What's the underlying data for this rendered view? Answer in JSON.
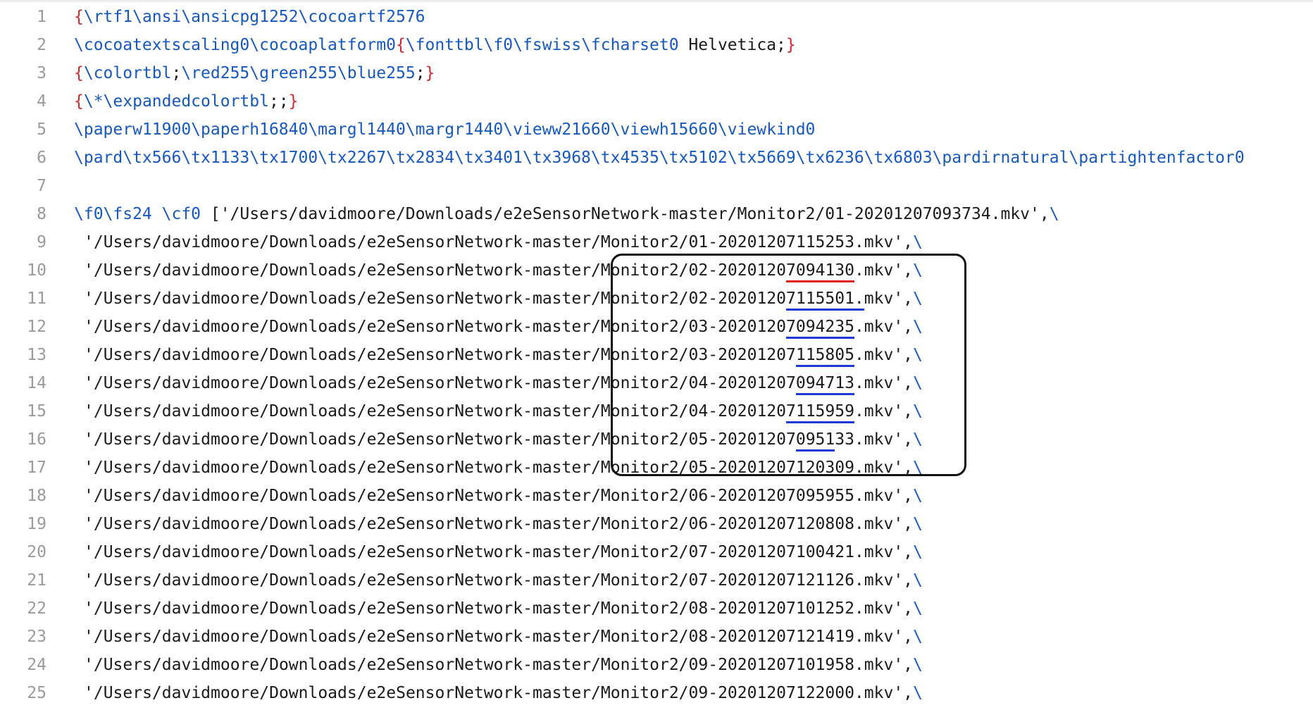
{
  "editor": {
    "lines": [
      {
        "n": "1",
        "segments": [
          [
            "brace",
            "{"
          ],
          [
            "cmd",
            "\\rtf1\\ansi\\ansicpg1252\\cocoartf2576"
          ]
        ]
      },
      {
        "n": "2",
        "segments": [
          [
            "cmd",
            "\\cocoatextscaling0\\cocoaplatform0"
          ],
          [
            "brace",
            "{"
          ],
          [
            "cmd",
            "\\fonttbl\\f0\\fswiss\\fcharset0"
          ],
          [
            "text",
            " Helvetica;"
          ],
          [
            "brace",
            "}"
          ]
        ]
      },
      {
        "n": "3",
        "segments": [
          [
            "brace",
            "{"
          ],
          [
            "cmd",
            "\\colortbl"
          ],
          [
            "text",
            ";"
          ],
          [
            "cmd",
            "\\red255\\green255\\blue255"
          ],
          [
            "text",
            ";"
          ],
          [
            "brace",
            "}"
          ]
        ]
      },
      {
        "n": "4",
        "segments": [
          [
            "brace",
            "{"
          ],
          [
            "cmd",
            "\\*\\expandedcolortbl"
          ],
          [
            "text",
            ";;"
          ],
          [
            "brace",
            "}"
          ]
        ]
      },
      {
        "n": "5",
        "segments": [
          [
            "cmd",
            "\\paperw11900\\paperh16840\\margl1440\\margr1440\\vieww21660\\viewh15660\\viewkind0"
          ]
        ]
      },
      {
        "n": "6",
        "segments": [
          [
            "cmd",
            "\\pard\\tx566\\tx1133\\tx1700\\tx2267\\tx2834\\tx3401\\tx3968\\tx4535\\tx5102\\tx5669\\tx6236\\tx6803\\pardirnatural\\partightenfactor0"
          ]
        ]
      },
      {
        "n": "7",
        "segments": []
      },
      {
        "n": "8",
        "segments": [
          [
            "cmd",
            "\\f0\\fs24 \\cf0"
          ],
          [
            "text",
            " ['/Users/davidmoore/Downloads/e2eSensorNetwork-master/Monitor2/01-20201207093734.mkv',"
          ],
          [
            "bs",
            "\\"
          ]
        ]
      },
      {
        "n": "9",
        "indent": true,
        "segments": [
          [
            "text",
            "'/Users/davidmoore/Downloads/e2eSensorNetwork-master/Monitor2/01-20201207115253.mkv',"
          ],
          [
            "bs",
            "\\"
          ]
        ]
      },
      {
        "n": "10",
        "indent": true,
        "segments": [
          [
            "text",
            "'/Users/davidmoore/Downloads/e2eSensorNetwork-master/Monitor2/02-2020120"
          ],
          [
            "red",
            "7094130"
          ],
          [
            "text",
            ".mkv',"
          ],
          [
            "bs",
            "\\"
          ]
        ]
      },
      {
        "n": "11",
        "indent": true,
        "segments": [
          [
            "text",
            "'/Users/davidmoore/Downloads/e2eSensorNetwork-master/Monitor2/02-2020120"
          ],
          [
            "blue",
            "7115501."
          ],
          [
            "text",
            "mkv',"
          ],
          [
            "bs",
            "\\"
          ]
        ]
      },
      {
        "n": "12",
        "indent": true,
        "segments": [
          [
            "text",
            "'/Users/davidmoore/Downloads/e2eSensorNetwork-master/Monitor2/03-2020120"
          ],
          [
            "blue",
            "7094235"
          ],
          [
            "text",
            ".mkv',"
          ],
          [
            "bs",
            "\\"
          ]
        ]
      },
      {
        "n": "13",
        "indent": true,
        "segments": [
          [
            "text",
            "'/Users/davidmoore/Downloads/e2eSensorNetwork-master/Monitor2/03-20201207"
          ],
          [
            "blue",
            "115805"
          ],
          [
            "text",
            ".mkv',"
          ],
          [
            "bs",
            "\\"
          ]
        ]
      },
      {
        "n": "14",
        "indent": true,
        "segments": [
          [
            "text",
            "'/Users/davidmoore/Downloads/e2eSensorNetwork-master/Monitor2/04-20201207"
          ],
          [
            "blue",
            "094713"
          ],
          [
            "text",
            ".mkv',"
          ],
          [
            "bs",
            "\\"
          ]
        ]
      },
      {
        "n": "15",
        "indent": true,
        "segments": [
          [
            "text",
            "'/Users/davidmoore/Downloads/e2eSensorNetwork-master/Monitor2/04-2020120"
          ],
          [
            "blue",
            "7115959"
          ],
          [
            "text",
            ".mkv',"
          ],
          [
            "bs",
            "\\"
          ]
        ]
      },
      {
        "n": "16",
        "indent": true,
        "segments": [
          [
            "text",
            "'/Users/davidmoore/Downloads/e2eSensorNetwork-master/Monitor2/05-20201207"
          ],
          [
            "blue",
            "0951"
          ],
          [
            "text",
            "33.mkv',"
          ],
          [
            "bs",
            "\\"
          ]
        ]
      },
      {
        "n": "17",
        "indent": true,
        "segments": [
          [
            "text",
            "'/Users/davidmoore/Downloads/e2eSensorNetwork-master/Monitor2/05-20201207120309.mkv',"
          ],
          [
            "bs",
            "\\"
          ]
        ]
      },
      {
        "n": "18",
        "indent": true,
        "segments": [
          [
            "text",
            "'/Users/davidmoore/Downloads/e2eSensorNetwork-master/Monitor2/06-20201207095955.mkv',"
          ],
          [
            "bs",
            "\\"
          ]
        ]
      },
      {
        "n": "19",
        "indent": true,
        "segments": [
          [
            "text",
            "'/Users/davidmoore/Downloads/e2eSensorNetwork-master/Monitor2/06-20201207120808.mkv',"
          ],
          [
            "bs",
            "\\"
          ]
        ]
      },
      {
        "n": "20",
        "indent": true,
        "segments": [
          [
            "text",
            "'/Users/davidmoore/Downloads/e2eSensorNetwork-master/Monitor2/07-20201207100421.mkv',"
          ],
          [
            "bs",
            "\\"
          ]
        ]
      },
      {
        "n": "21",
        "indent": true,
        "segments": [
          [
            "text",
            "'/Users/davidmoore/Downloads/e2eSensorNetwork-master/Monitor2/07-20201207121126.mkv',"
          ],
          [
            "bs",
            "\\"
          ]
        ]
      },
      {
        "n": "22",
        "indent": true,
        "segments": [
          [
            "text",
            "'/Users/davidmoore/Downloads/e2eSensorNetwork-master/Monitor2/08-20201207101252.mkv',"
          ],
          [
            "bs",
            "\\"
          ]
        ]
      },
      {
        "n": "23",
        "indent": true,
        "segments": [
          [
            "text",
            "'/Users/davidmoore/Downloads/e2eSensorNetwork-master/Monitor2/08-20201207121419.mkv',"
          ],
          [
            "bs",
            "\\"
          ]
        ]
      },
      {
        "n": "24",
        "indent": true,
        "segments": [
          [
            "text",
            "'/Users/davidmoore/Downloads/e2eSensorNetwork-master/Monitor2/09-20201207101958.mkv',"
          ],
          [
            "bs",
            "\\"
          ]
        ]
      },
      {
        "n": "25",
        "indent": true,
        "segments": [
          [
            "text",
            "'/Users/davidmoore/Downloads/e2eSensorNetwork-master/Monitor2/09-20201207122000.mkv',"
          ],
          [
            "bs",
            "\\"
          ]
        ]
      }
    ],
    "colors": {
      "brace": "#d4242c",
      "command": "#1558c0",
      "text": "#1a1a1a",
      "line_number": "#9a9a9a",
      "underline_red": "#e0221c",
      "underline_blue": "#1f3ad8",
      "highlight_box": "#111111"
    }
  }
}
